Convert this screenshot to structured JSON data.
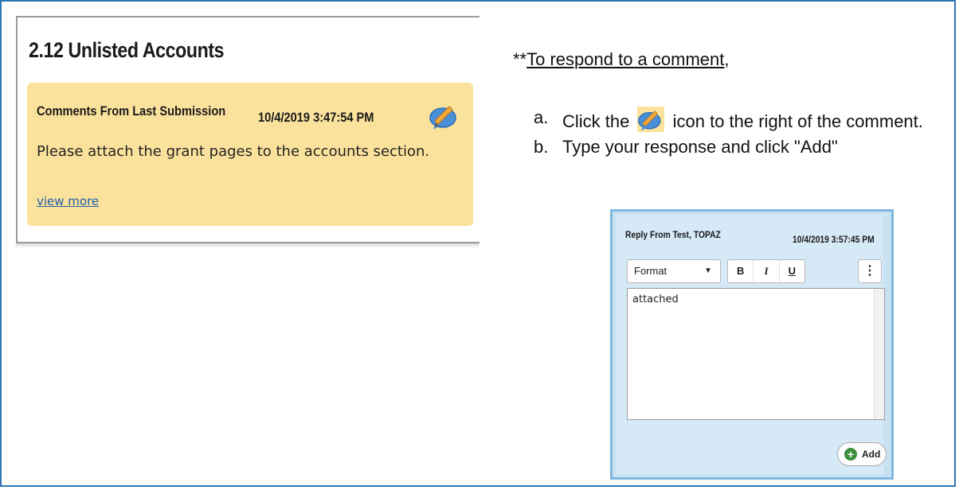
{
  "left_panel": {
    "section_title": "2.12 Unlisted Accounts",
    "comment": {
      "header": "Comments From Last Submission",
      "date": "10/4/2019 3:47:54 PM",
      "body": "Please attach the grant pages to the accounts section.",
      "view_more": "view more"
    },
    "reply_icon": "edit-reply-icon"
  },
  "instructions": {
    "prefix": "**",
    "heading": "To respond to a comment",
    "heading_suffix": ",",
    "steps": [
      {
        "letter": "a.",
        "before": "Click the",
        "after": "icon to the right of the comment."
      },
      {
        "letter": "b.",
        "text": "Type your response and click \"Add\""
      }
    ]
  },
  "reply_panel": {
    "header": "Reply From Test, TOPAZ",
    "date": "10/4/2019 3:57:45 PM",
    "toolbar": {
      "format_label": "Format",
      "bold": "B",
      "italic": "I",
      "underline": "U",
      "more": "⋮"
    },
    "editor_text": "attached",
    "add_label": "Add"
  },
  "colors": {
    "frame_border": "#2e75b6",
    "comment_bg": "#fbe29c",
    "reply_bg": "#d6e9f7",
    "link": "#1f5fa8",
    "add_icon": "#3d8f3d"
  }
}
